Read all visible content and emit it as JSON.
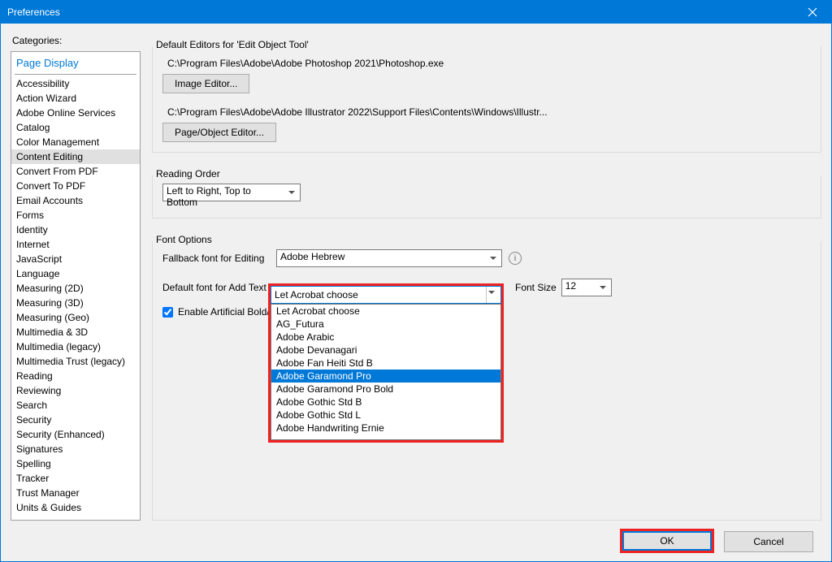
{
  "window": {
    "title": "Preferences"
  },
  "categories": {
    "label": "Categories:",
    "top": "Page Display",
    "items": [
      "Accessibility",
      "Action Wizard",
      "Adobe Online Services",
      "Catalog",
      "Color Management",
      "Content Editing",
      "Convert From PDF",
      "Convert To PDF",
      "Email Accounts",
      "Forms",
      "Identity",
      "Internet",
      "JavaScript",
      "Language",
      "Measuring (2D)",
      "Measuring (3D)",
      "Measuring (Geo)",
      "Multimedia & 3D",
      "Multimedia (legacy)",
      "Multimedia Trust (legacy)",
      "Reading",
      "Reviewing",
      "Search",
      "Security",
      "Security (Enhanced)",
      "Signatures",
      "Spelling",
      "Tracker",
      "Trust Manager",
      "Units & Guides"
    ],
    "selected": "Content Editing"
  },
  "defaultEditors": {
    "title": "Default Editors for 'Edit Object Tool'",
    "imagePath": "C:\\Program Files\\Adobe\\Adobe Photoshop 2021\\Photoshop.exe",
    "imageBtn": "Image Editor...",
    "pagePath": "C:\\Program Files\\Adobe\\Adobe Illustrator 2022\\Support Files\\Contents\\Windows\\Illustr...",
    "pageBtn": "Page/Object Editor..."
  },
  "readingOrder": {
    "title": "Reading Order",
    "value": "Left to Right, Top to Bottom"
  },
  "fontOptions": {
    "title": "Font Options",
    "fallbackLabel": "Fallback font for Editing",
    "fallbackValue": "Adobe Hebrew",
    "defaultLabel": "Default font for Add Text",
    "defaultValue": "Let Acrobat choose",
    "fontSizeLabel": "Font Size",
    "fontSizeValue": "12",
    "enableArtificial": "Enable Artificial Bold/Ita",
    "dropdownOptions": [
      "Let Acrobat choose",
      "AG_Futura",
      "Adobe Arabic",
      "Adobe Devanagari",
      "Adobe Fan Heiti Std B",
      "Adobe Garamond Pro",
      "Adobe Garamond Pro Bold",
      "Adobe Gothic Std B",
      "Adobe Gothic Std L",
      "Adobe Handwriting Ernie"
    ],
    "dropdownSelected": "Adobe Garamond Pro"
  },
  "buttons": {
    "ok": "OK",
    "cancel": "Cancel"
  }
}
